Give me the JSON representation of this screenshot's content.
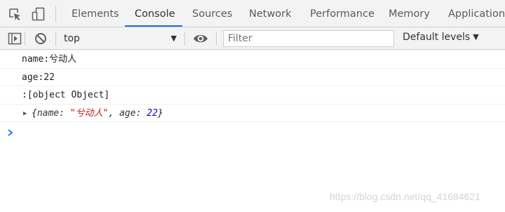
{
  "tabs": [
    {
      "label": "Elements",
      "active": false
    },
    {
      "label": "Console",
      "active": true
    },
    {
      "label": "Sources",
      "active": false
    },
    {
      "label": "Network",
      "active": false
    },
    {
      "label": "Performance",
      "active": false
    },
    {
      "label": "Memory",
      "active": false
    },
    {
      "label": "Application",
      "active": false
    }
  ],
  "toolbar": {
    "context_value": "top",
    "filter_placeholder": "Filter",
    "levels_label": "Default levels"
  },
  "messages": [
    {
      "text": "name:兮动人"
    },
    {
      "text": "age:22"
    },
    {
      "text": ":[object Object]"
    }
  ],
  "object_preview": {
    "key1": "name:",
    "val1": "\"兮动人\"",
    "sep": ", ",
    "key2": "age:",
    "val2": "22"
  },
  "watermark": "https://blog.csdn.net/qq_41684621",
  "colors": {
    "accent": "#1a73e8",
    "string": "#c41a16",
    "number": "#1c00cf",
    "toolbar_bg": "#f3f3f3"
  }
}
